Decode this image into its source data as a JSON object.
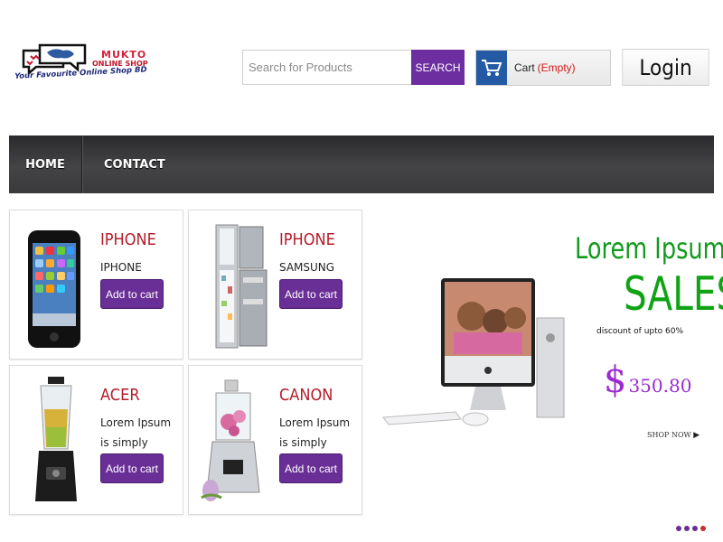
{
  "header": {
    "logo": {
      "title": "MUKTO",
      "subtitle": "ONLINE SHOP",
      "tagline": "Your Favourite Online Shop BD"
    },
    "search": {
      "placeholder": "Search for Products",
      "value": "",
      "button_label": "SEARCH"
    },
    "cart": {
      "label": "Cart",
      "status": "(Empty)",
      "icon": "shopping-cart-icon"
    },
    "login_label": "Login"
  },
  "nav": {
    "items": [
      {
        "label": "HOME"
      },
      {
        "label": "CONTACT"
      }
    ]
  },
  "products": [
    {
      "title": "IPHONE",
      "desc": "IPHONE",
      "button": "Add to cart",
      "image": "smartphone"
    },
    {
      "title": "IPHONE",
      "desc": "SAMSUNG",
      "button": "Add to cart",
      "image": "refrigerator"
    },
    {
      "title": "ACER",
      "desc": "Lorem Ipsum is simply",
      "button": "Add to cart",
      "image": "blender"
    },
    {
      "title": "CANON",
      "desc": "Lorem Ipsum is simply",
      "button": "Add to cart",
      "image": "food-processor"
    }
  ],
  "banner": {
    "title1": "Lorem Ipsum",
    "title2": "SALES",
    "discount": "discount of upto  60%",
    "price_currency": "$",
    "price_value": "350.80",
    "shop_now": "SHOP NOW",
    "image": "imac-computer"
  },
  "slider": {
    "dot_count": 4,
    "active_index": 3
  },
  "colors": {
    "accent_purple": "#6a2f97",
    "cart_blue": "#245aa4",
    "title_red": "#b51d2a",
    "sales_green": "#119a1c",
    "price_purple": "#9b2bd0"
  }
}
